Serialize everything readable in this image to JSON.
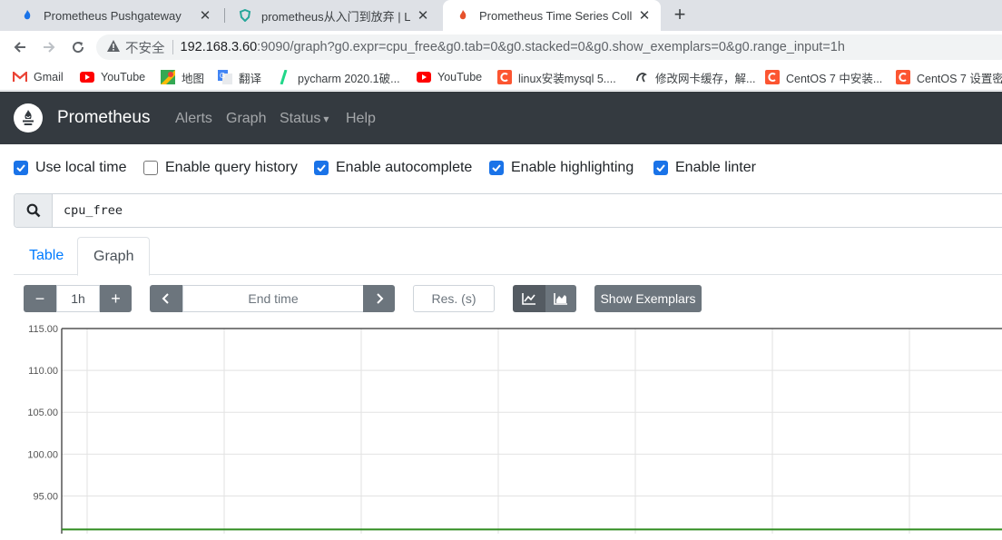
{
  "browser": {
    "tabs": [
      {
        "title": "Prometheus Pushgateway",
        "close": "✕"
      },
      {
        "title": "prometheus从入门到放弃 | Linux",
        "close": "✕"
      },
      {
        "title": "Prometheus Time Series Collection",
        "close": "✕"
      }
    ],
    "new_tab": "+",
    "address": {
      "security_label": "不安全",
      "host": "192.168.3.60",
      "path": ":9090/graph?g0.expr=cpu_free&g0.tab=0&g0.stacked=0&g0.show_exemplars=0&g0.range_input=1h"
    },
    "bookmarks": [
      {
        "label": "Gmail",
        "icon": "gmail-icon"
      },
      {
        "label": "YouTube",
        "icon": "youtube-icon"
      },
      {
        "label": "地图",
        "icon": "maps-icon"
      },
      {
        "label": "翻译",
        "icon": "translate-icon"
      },
      {
        "label": "pycharm 2020.1破...",
        "icon": "pycharm-icon"
      },
      {
        "label": "YouTube",
        "icon": "youtube-icon"
      },
      {
        "label": "linux安装mysql 5....",
        "icon": "csdn-icon"
      },
      {
        "label": "修改网卡缓存，解...",
        "icon": "site-icon"
      },
      {
        "label": "CentOS 7 中安装...",
        "icon": "csdn-icon"
      },
      {
        "label": "CentOS 7 设置密",
        "icon": "csdn-icon"
      }
    ]
  },
  "navbar": {
    "brand": "Prometheus",
    "links": [
      "Alerts",
      "Graph",
      "Status",
      "Help"
    ],
    "status_caret": "▾"
  },
  "options": [
    {
      "label": "Use local time",
      "checked": true
    },
    {
      "label": "Enable query history",
      "checked": false
    },
    {
      "label": "Enable autocomplete",
      "checked": true
    },
    {
      "label": "Enable highlighting",
      "checked": true
    },
    {
      "label": "Enable linter",
      "checked": true
    }
  ],
  "query": {
    "expression": "cpu_free"
  },
  "panel_tabs": [
    {
      "label": "Table",
      "active": false
    },
    {
      "label": "Graph",
      "active": true
    }
  ],
  "graph_controls": {
    "minus": "−",
    "range": "1h",
    "plus": "+",
    "prev": "‹",
    "end_time_placeholder": "End time",
    "next": "›",
    "resolution_placeholder": "Res. (s)",
    "show_exemplars": "Show Exemplars"
  },
  "colors": {
    "navbar": "#343a40",
    "button": "#6c757d",
    "link": "#007bff",
    "checkbox": "#1a73e8",
    "series": "#2f8c1f"
  },
  "chart_data": {
    "type": "line",
    "y_ticks": [
      "115.00",
      "110.00",
      "105.00",
      "100.00",
      "95.00"
    ],
    "ylim": [
      90.5,
      115
    ],
    "grid": true,
    "series": [
      {
        "values": [
          91,
          91,
          91
        ]
      }
    ]
  }
}
